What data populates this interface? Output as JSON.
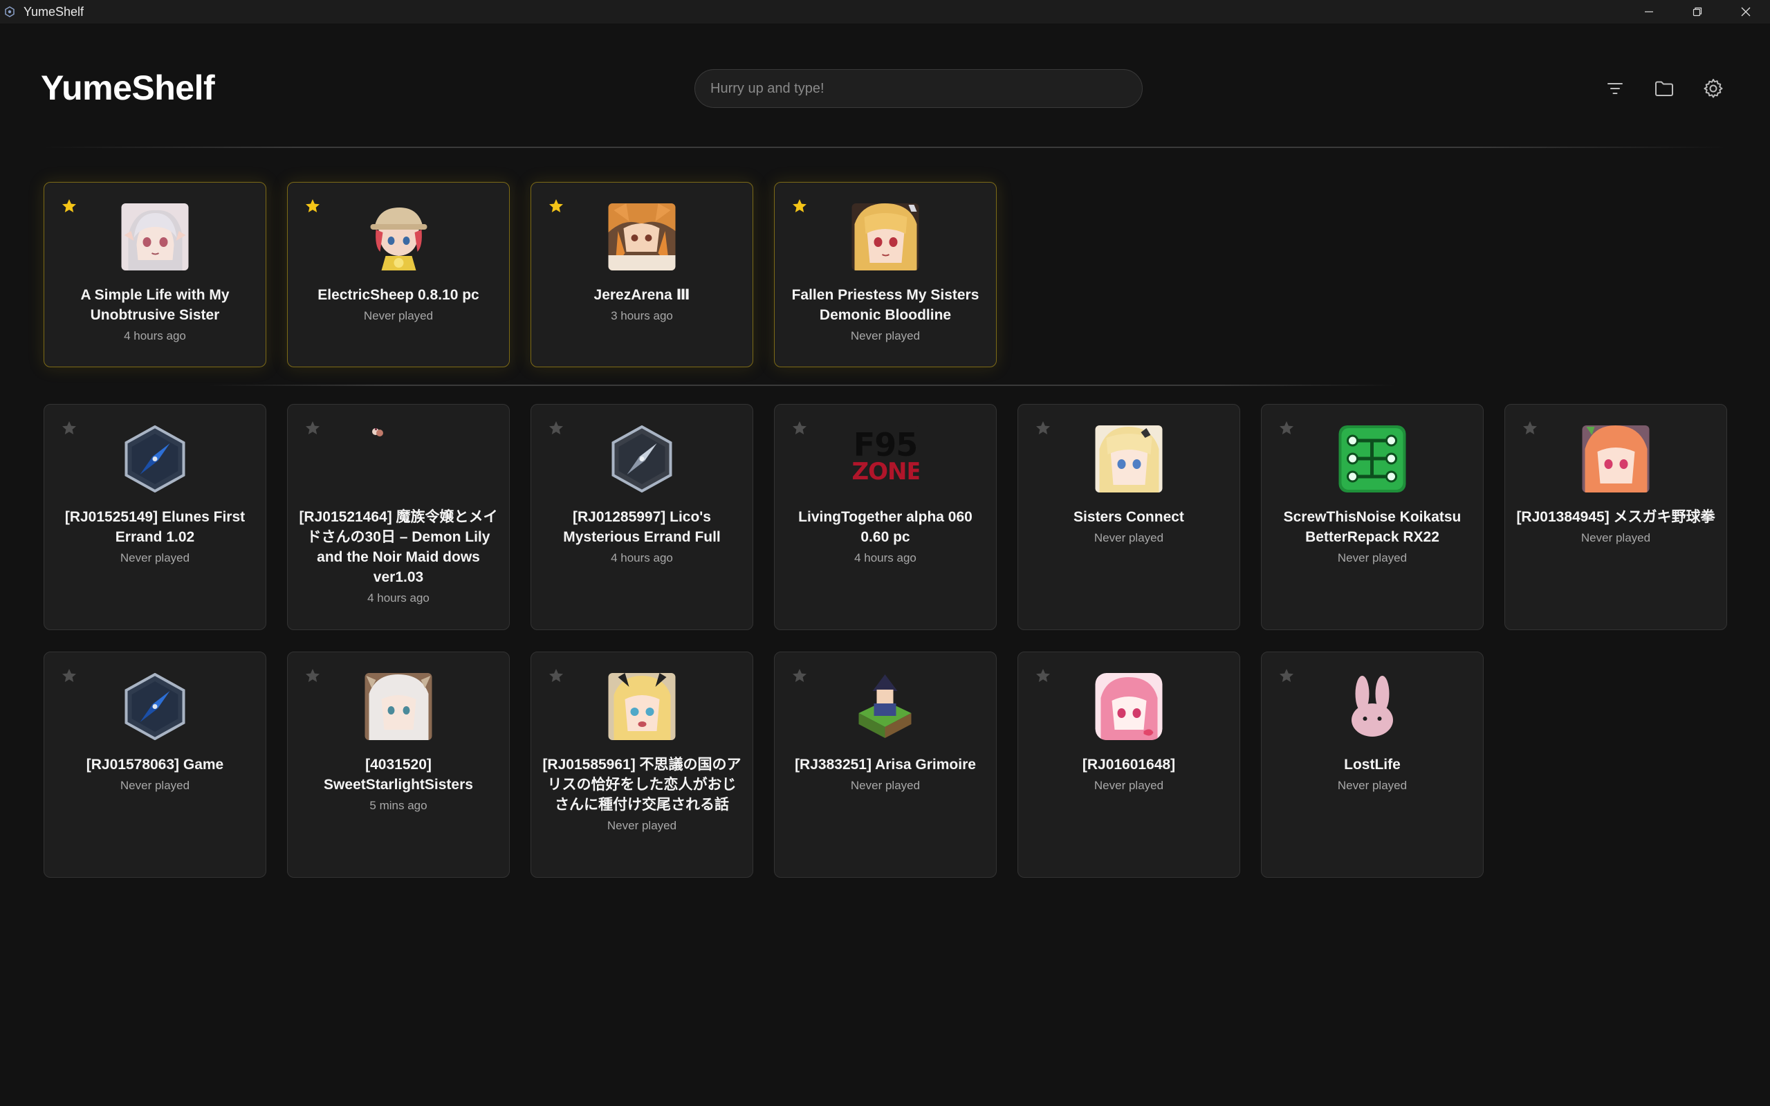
{
  "window": {
    "title": "YumeShelf",
    "minimize_label": "",
    "maximize_label": "",
    "close_label": ""
  },
  "header": {
    "brand": "YumeShelf",
    "search_placeholder": "Hurry up and type!",
    "icons": [
      "filter-icon",
      "folder-icon",
      "settings-icon"
    ]
  },
  "colors": {
    "background": "#121212",
    "card": "#1e1e1e",
    "favorite_border": "#7c6a17",
    "star_active": "#f5c518",
    "star_inactive": "#555555"
  },
  "favorites": [
    {
      "title": "A Simple Life with My Unobtrusive Sister",
      "last_played": "4 hours ago"
    },
    {
      "title": "ElectricSheep 0.8.10 pc",
      "last_played": "Never played"
    },
    {
      "title": "JerezArena Ⅲ",
      "last_played": "3 hours ago"
    },
    {
      "title": "Fallen Priestess My Sisters Demonic Bloodline",
      "last_played": "Never played"
    }
  ],
  "library": [
    {
      "title": "[RJ01525149] Elunes First Errand 1.02",
      "last_played": "Never played"
    },
    {
      "title": "[RJ01521464] 魔族令嬢とメイドさんの30日 – Demon Lily and the Noir Maid dows ver1.03",
      "last_played": "4 hours ago"
    },
    {
      "title": "[RJ01285997] Lico's Mysterious Errand Full",
      "last_played": "4 hours ago"
    },
    {
      "title": "LivingTogether alpha 060 0.60 pc",
      "last_played": "4 hours ago",
      "logo_text_top": "F95",
      "logo_text_bottom": "ZONE"
    },
    {
      "title": "Sisters Connect",
      "last_played": "Never played"
    },
    {
      "title": "ScrewThisNoise Koikatsu BetterRepack RX22",
      "last_played": "Never played"
    },
    {
      "title": "[RJ01384945] メスガキ野球拳",
      "last_played": "Never played"
    },
    {
      "title": "[RJ01578063] Game",
      "last_played": "Never played"
    },
    {
      "title": "[4031520] SweetStarlightSisters",
      "last_played": "5 mins ago"
    },
    {
      "title": "[RJ01585961] 不思議の国のアリスの恰好をした恋人がおじさんに種付け交尾される話",
      "last_played": "Never played"
    },
    {
      "title": "[RJ383251] Arisa Grimoire",
      "last_played": "Never played"
    },
    {
      "title": "[RJ01601648]",
      "last_played": "Never played"
    },
    {
      "title": "LostLife",
      "last_played": "Never played"
    }
  ]
}
